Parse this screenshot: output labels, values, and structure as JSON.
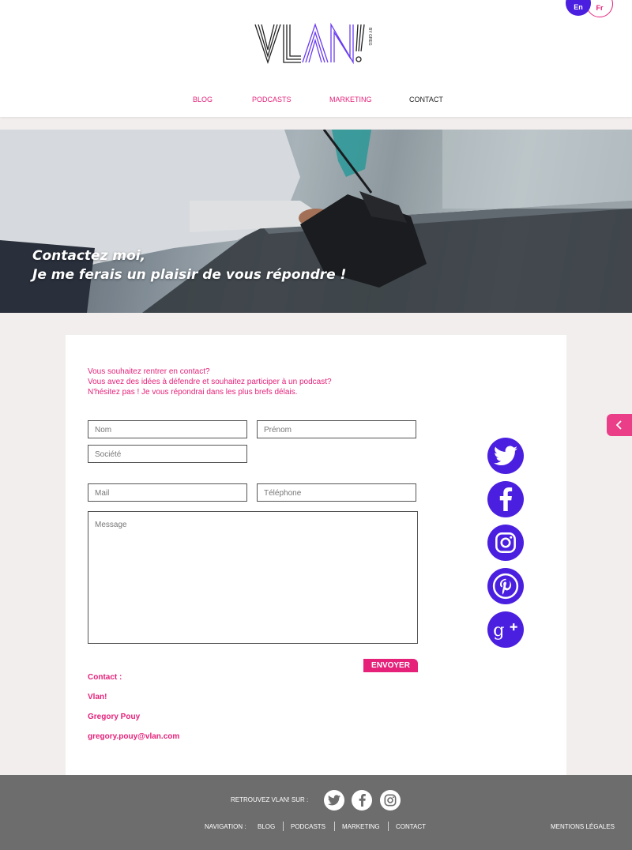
{
  "header": {
    "lang": {
      "en": "En",
      "fr": "Fr"
    },
    "logo_text": "VLAN!",
    "logo_tag": "BY GREG",
    "nav": [
      "BLOG",
      "PODCASTS",
      "MARKETING",
      "CONTACT"
    ]
  },
  "hero": {
    "line1": "Contactez moi,",
    "line2": "Je me ferais un plaisir de vous répondre !"
  },
  "form": {
    "intro": [
      "Vous souhaitez rentrer en contact?",
      "Vous avez des idées à défendre et souhaitez participer à un podcast?",
      "N'hésitez pas ! Je vous répondrai dans les plus brefs délais."
    ],
    "placeholders": {
      "nom": "Nom",
      "prenom": "Prénom",
      "societe": "Société",
      "mail": "Mail",
      "telephone": "Téléphone",
      "message": "Message"
    },
    "send_label": "ENVOYER"
  },
  "contact": {
    "heading": "Contact :",
    "company": "Vlan!",
    "name": "Gregory Pouy",
    "email": "gregory.pouy@vlan.com"
  },
  "footer": {
    "find_label": "RETROUVEZ VLAN! SUR :",
    "nav_label": "NAVIGATION :",
    "nav": [
      "BLOG",
      "PODCASTS",
      "MARKETING",
      "CONTACT"
    ],
    "legal": "MENTIONS LÉGALES"
  },
  "colors": {
    "accent": "#e5217a",
    "brand": "#4a1fe0",
    "footer": "#6d6d6d",
    "background": "#f3eeee"
  },
  "icons": [
    "twitter-icon",
    "facebook-icon",
    "instagram-icon",
    "pinterest-icon",
    "google-plus-icon",
    "chevron-left-icon"
  ]
}
